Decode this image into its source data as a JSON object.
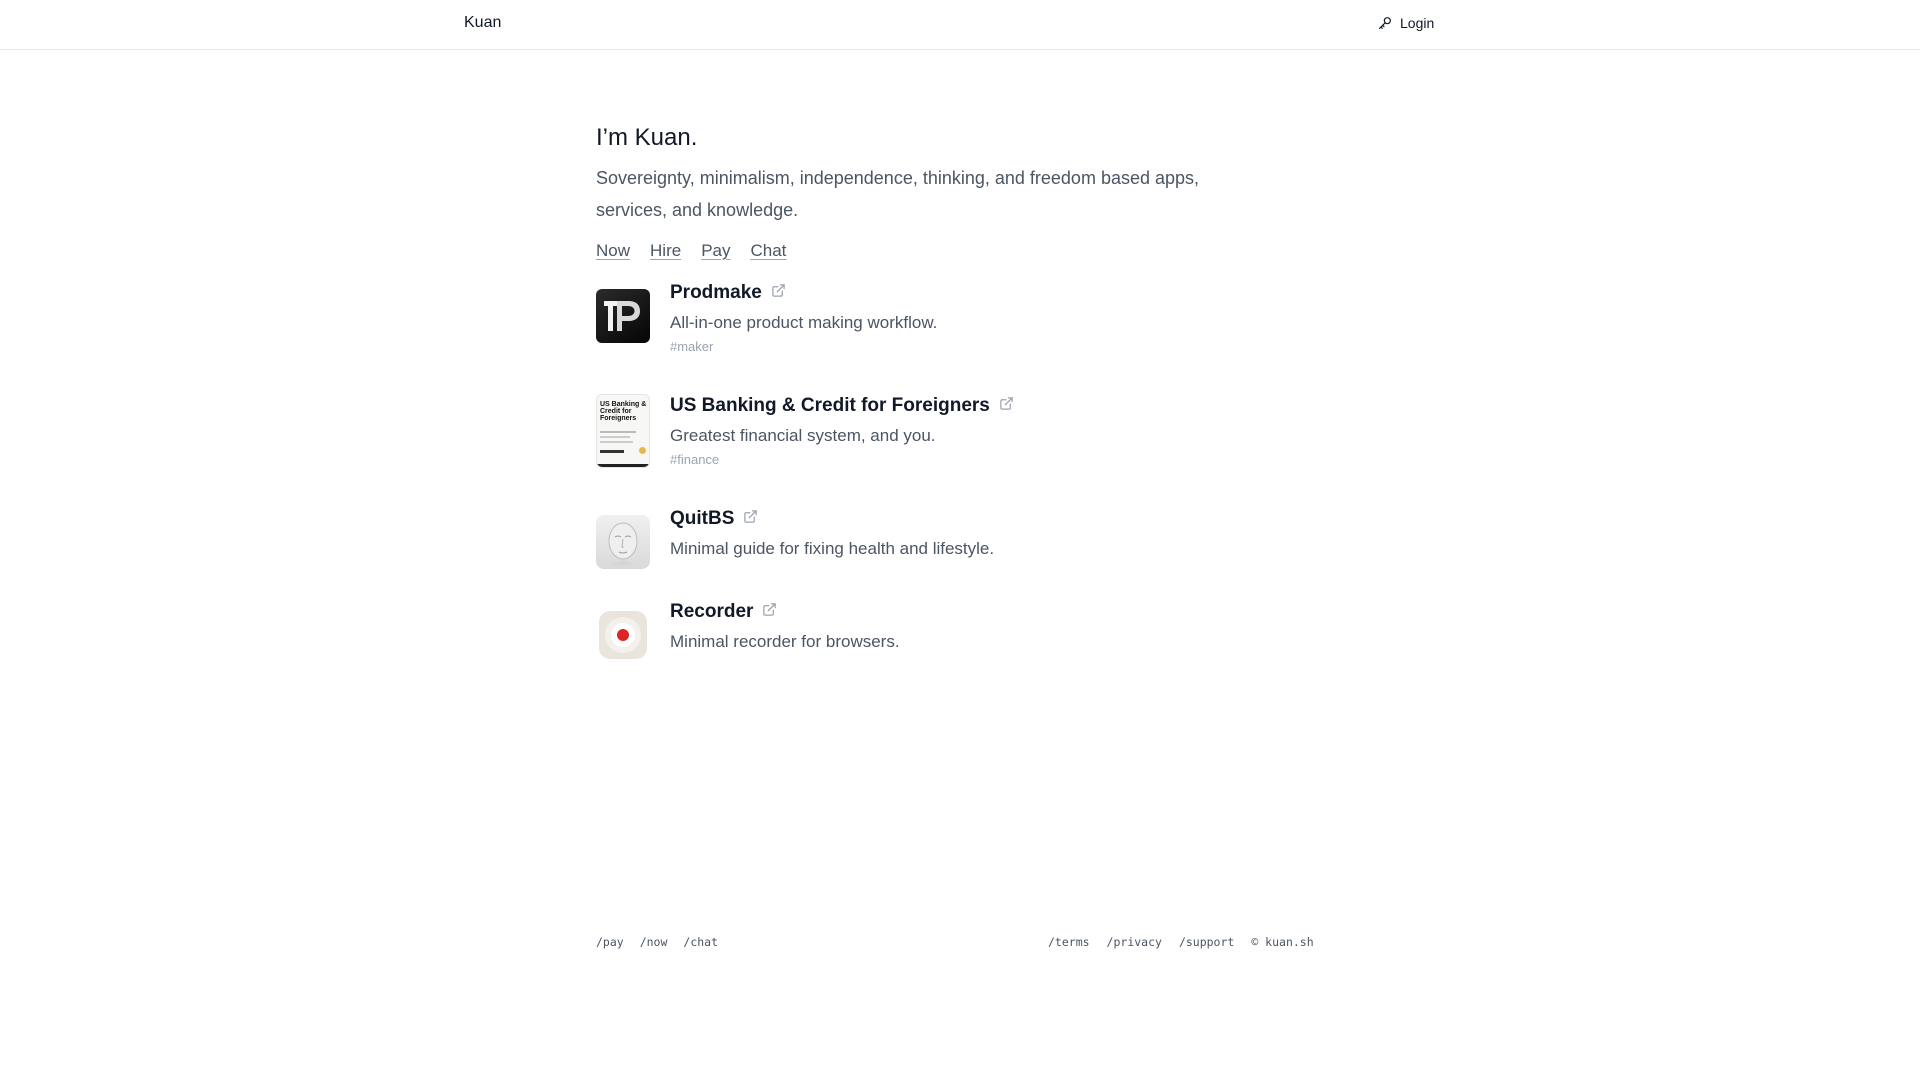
{
  "header": {
    "brand": "Kuan",
    "login_label": "Login",
    "login_icon": "key-icon"
  },
  "hero": {
    "title": "I’m Kuan.",
    "subtitle": "Sovereignty, minimalism, independence, thinking, and freedom based apps, services, and knowledge."
  },
  "quick_links": [
    "Now",
    "Hire",
    "Pay",
    "Chat"
  ],
  "projects": [
    {
      "title": "Prodmake",
      "description": "All-in-one product making workflow.",
      "tag": "#maker",
      "icon": "prodmake-logo"
    },
    {
      "title": "US Banking & Credit for Foreigners",
      "description": "Greatest financial system, and you.",
      "tag": "#finance",
      "icon": "book-cover-thumbnail",
      "thumb_text": [
        "US Banking &",
        "Credit for",
        "Foreigners"
      ]
    },
    {
      "title": "QuitBS",
      "description": "Minimal guide for fixing health and lifestyle.",
      "tag": "",
      "icon": "face-thumbnail"
    },
    {
      "title": "Recorder",
      "description": "Minimal recorder for browsers.",
      "tag": "",
      "icon": "record-button-thumbnail"
    }
  ],
  "footer": {
    "left_links": [
      "/pay",
      "/now",
      "/chat"
    ],
    "right_links": [
      "/terms",
      "/privacy",
      "/support"
    ],
    "copyright": "© kuan.sh"
  },
  "colors": {
    "text": "#111827",
    "muted": "#4b5563",
    "tag": "#9ca3af",
    "border": "#e5e7eb",
    "record_red": "#dc2626"
  }
}
